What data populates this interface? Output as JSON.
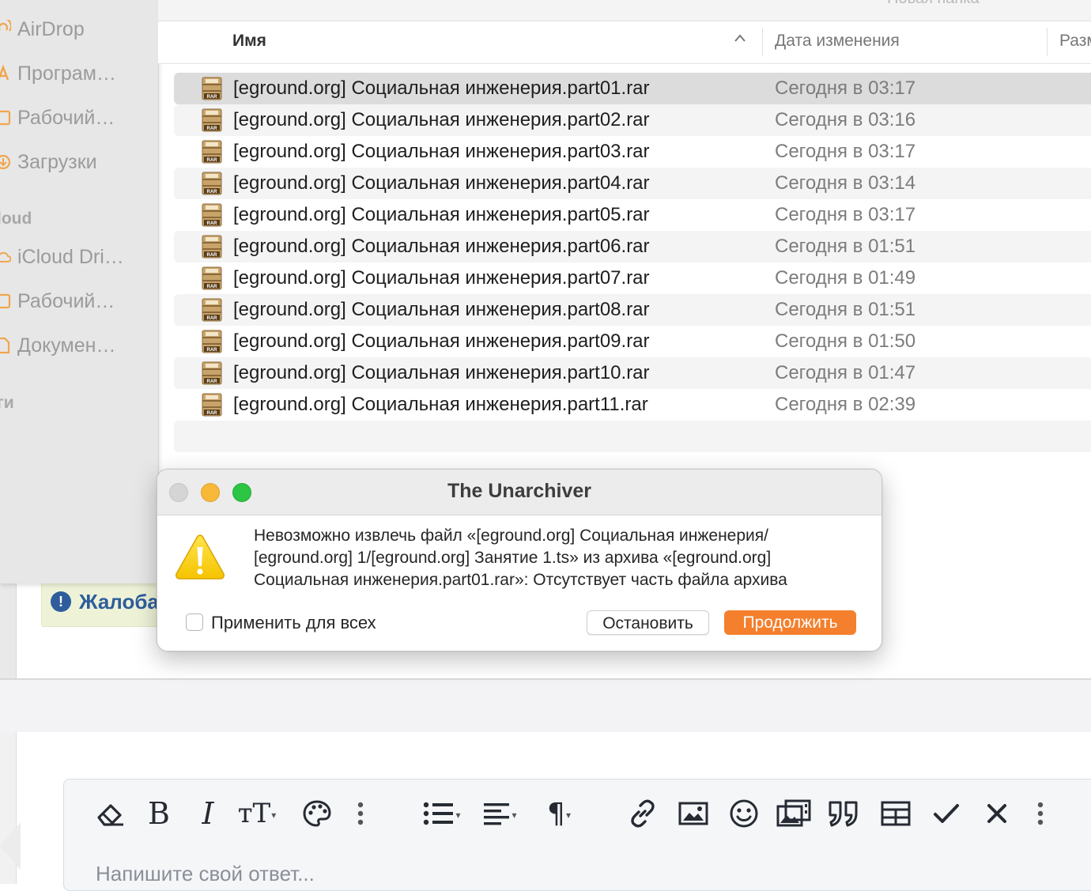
{
  "finder": {
    "toolbar_title": "Новая папка",
    "sidebar": {
      "items_top": [
        {
          "label": "AirDrop",
          "icon": "airdrop-icon"
        },
        {
          "label": "Програм…",
          "icon": "applications-icon"
        },
        {
          "label": "Рабочий…",
          "icon": "desktop-icon"
        },
        {
          "label": "Загрузки",
          "icon": "downloads-icon"
        }
      ],
      "heading_icloud": "loud",
      "items_icloud": [
        {
          "label": "iCloud Dri…",
          "icon": "icloud-icon"
        },
        {
          "label": "Рабочий…",
          "icon": "desktop-icon"
        },
        {
          "label": "Докумен…",
          "icon": "documents-icon"
        }
      ],
      "heading_tags": "ги"
    },
    "columns": {
      "name": "Имя",
      "date": "Дата изменения",
      "size": "Разм"
    },
    "files": [
      {
        "name": "[eground.org] Социальная инженерия.part01.rar",
        "date": "Сегодня в 03:17"
      },
      {
        "name": "[eground.org] Социальная инженерия.part02.rar",
        "date": "Сегодня в 03:16"
      },
      {
        "name": "[eground.org] Социальная инженерия.part03.rar",
        "date": "Сегодня в 03:17"
      },
      {
        "name": "[eground.org] Социальная инженерия.part04.rar",
        "date": "Сегодня в 03:14"
      },
      {
        "name": "[eground.org] Социальная инженерия.part05.rar",
        "date": "Сегодня в 03:17"
      },
      {
        "name": "[eground.org] Социальная инженерия.part06.rar",
        "date": "Сегодня в 01:51"
      },
      {
        "name": "[eground.org] Социальная инженерия.part07.rar",
        "date": "Сегодня в 01:49"
      },
      {
        "name": "[eground.org] Социальная инженерия.part08.rar",
        "date": "Сегодня в 01:51"
      },
      {
        "name": "[eground.org] Социальная инженерия.part09.rar",
        "date": "Сегодня в 01:50"
      },
      {
        "name": "[eground.org] Социальная инженерия.part10.rar",
        "date": "Сегодня в 01:47"
      },
      {
        "name": "[eground.org] Социальная инженерия.part11.rar",
        "date": "Сегодня в 02:39"
      }
    ],
    "file_icon_label": "RAR"
  },
  "dialog": {
    "title": "The Unarchiver",
    "message_lines": [
      "Невозможно извлечь файл «[eground.org] Социальная инженерия/",
      "[eground.org] 1/[eground.org] Занятие 1.ts» из архива «[eground.org]",
      "Социальная инженерия.part01.rar»: Отсутствует часть файла архива"
    ],
    "apply_all_label": "Применить для всех",
    "stop_label": "Остановить",
    "continue_label": "Продолжить"
  },
  "page": {
    "report_label": "Жалоба",
    "editor_placeholder": "Напишите свой ответ...",
    "toolbar_icons": [
      "eraser-icon",
      "bold-icon",
      "italic-icon",
      "text-size-icon",
      "palette-icon",
      "more-vertical-icon",
      "list-icon",
      "align-icon",
      "paragraph-icon",
      "link-icon",
      "image-icon",
      "emoji-icon",
      "media-icon",
      "quote-icon",
      "table-icon",
      "check-icon",
      "close-icon",
      "more-vertical-icon"
    ]
  },
  "colors": {
    "accent_orange": "#f47f2c",
    "report_blue": "#2f5d9c",
    "traffic_yellow": "#f8b93a",
    "traffic_green": "#2dc544"
  }
}
